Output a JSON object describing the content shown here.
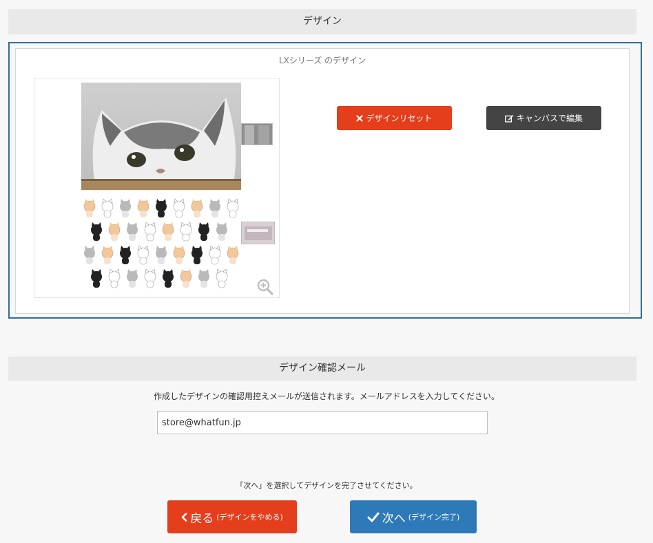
{
  "design_section": {
    "header": "デザイン",
    "title": "LXシリーズ のデザイン",
    "reset_label": "デザインリセット",
    "canvas_label": "キャンバスで編集"
  },
  "mail_section": {
    "header": "デザイン確認メール",
    "description": "作成したデザインの確認用控えメールが送信されます。メールアドレスを入力してください。",
    "email_value": "store@whatfun.jp"
  },
  "footer": {
    "note": "「次へ」を選択してデザインを完了させてください。",
    "back_label": "戻る",
    "back_sub": "(デザインをやめる)",
    "next_label": "次へ",
    "next_sub": "(デザイン完了)"
  },
  "colors": {
    "accent_red": "#e43e1c",
    "accent_blue": "#2e7ab8",
    "dark_button": "#444444",
    "frame_border": "#2e6ea0"
  },
  "icons": [
    "times-icon",
    "edit-icon",
    "zoom-in-icon",
    "chevron-left-icon",
    "check-icon"
  ]
}
